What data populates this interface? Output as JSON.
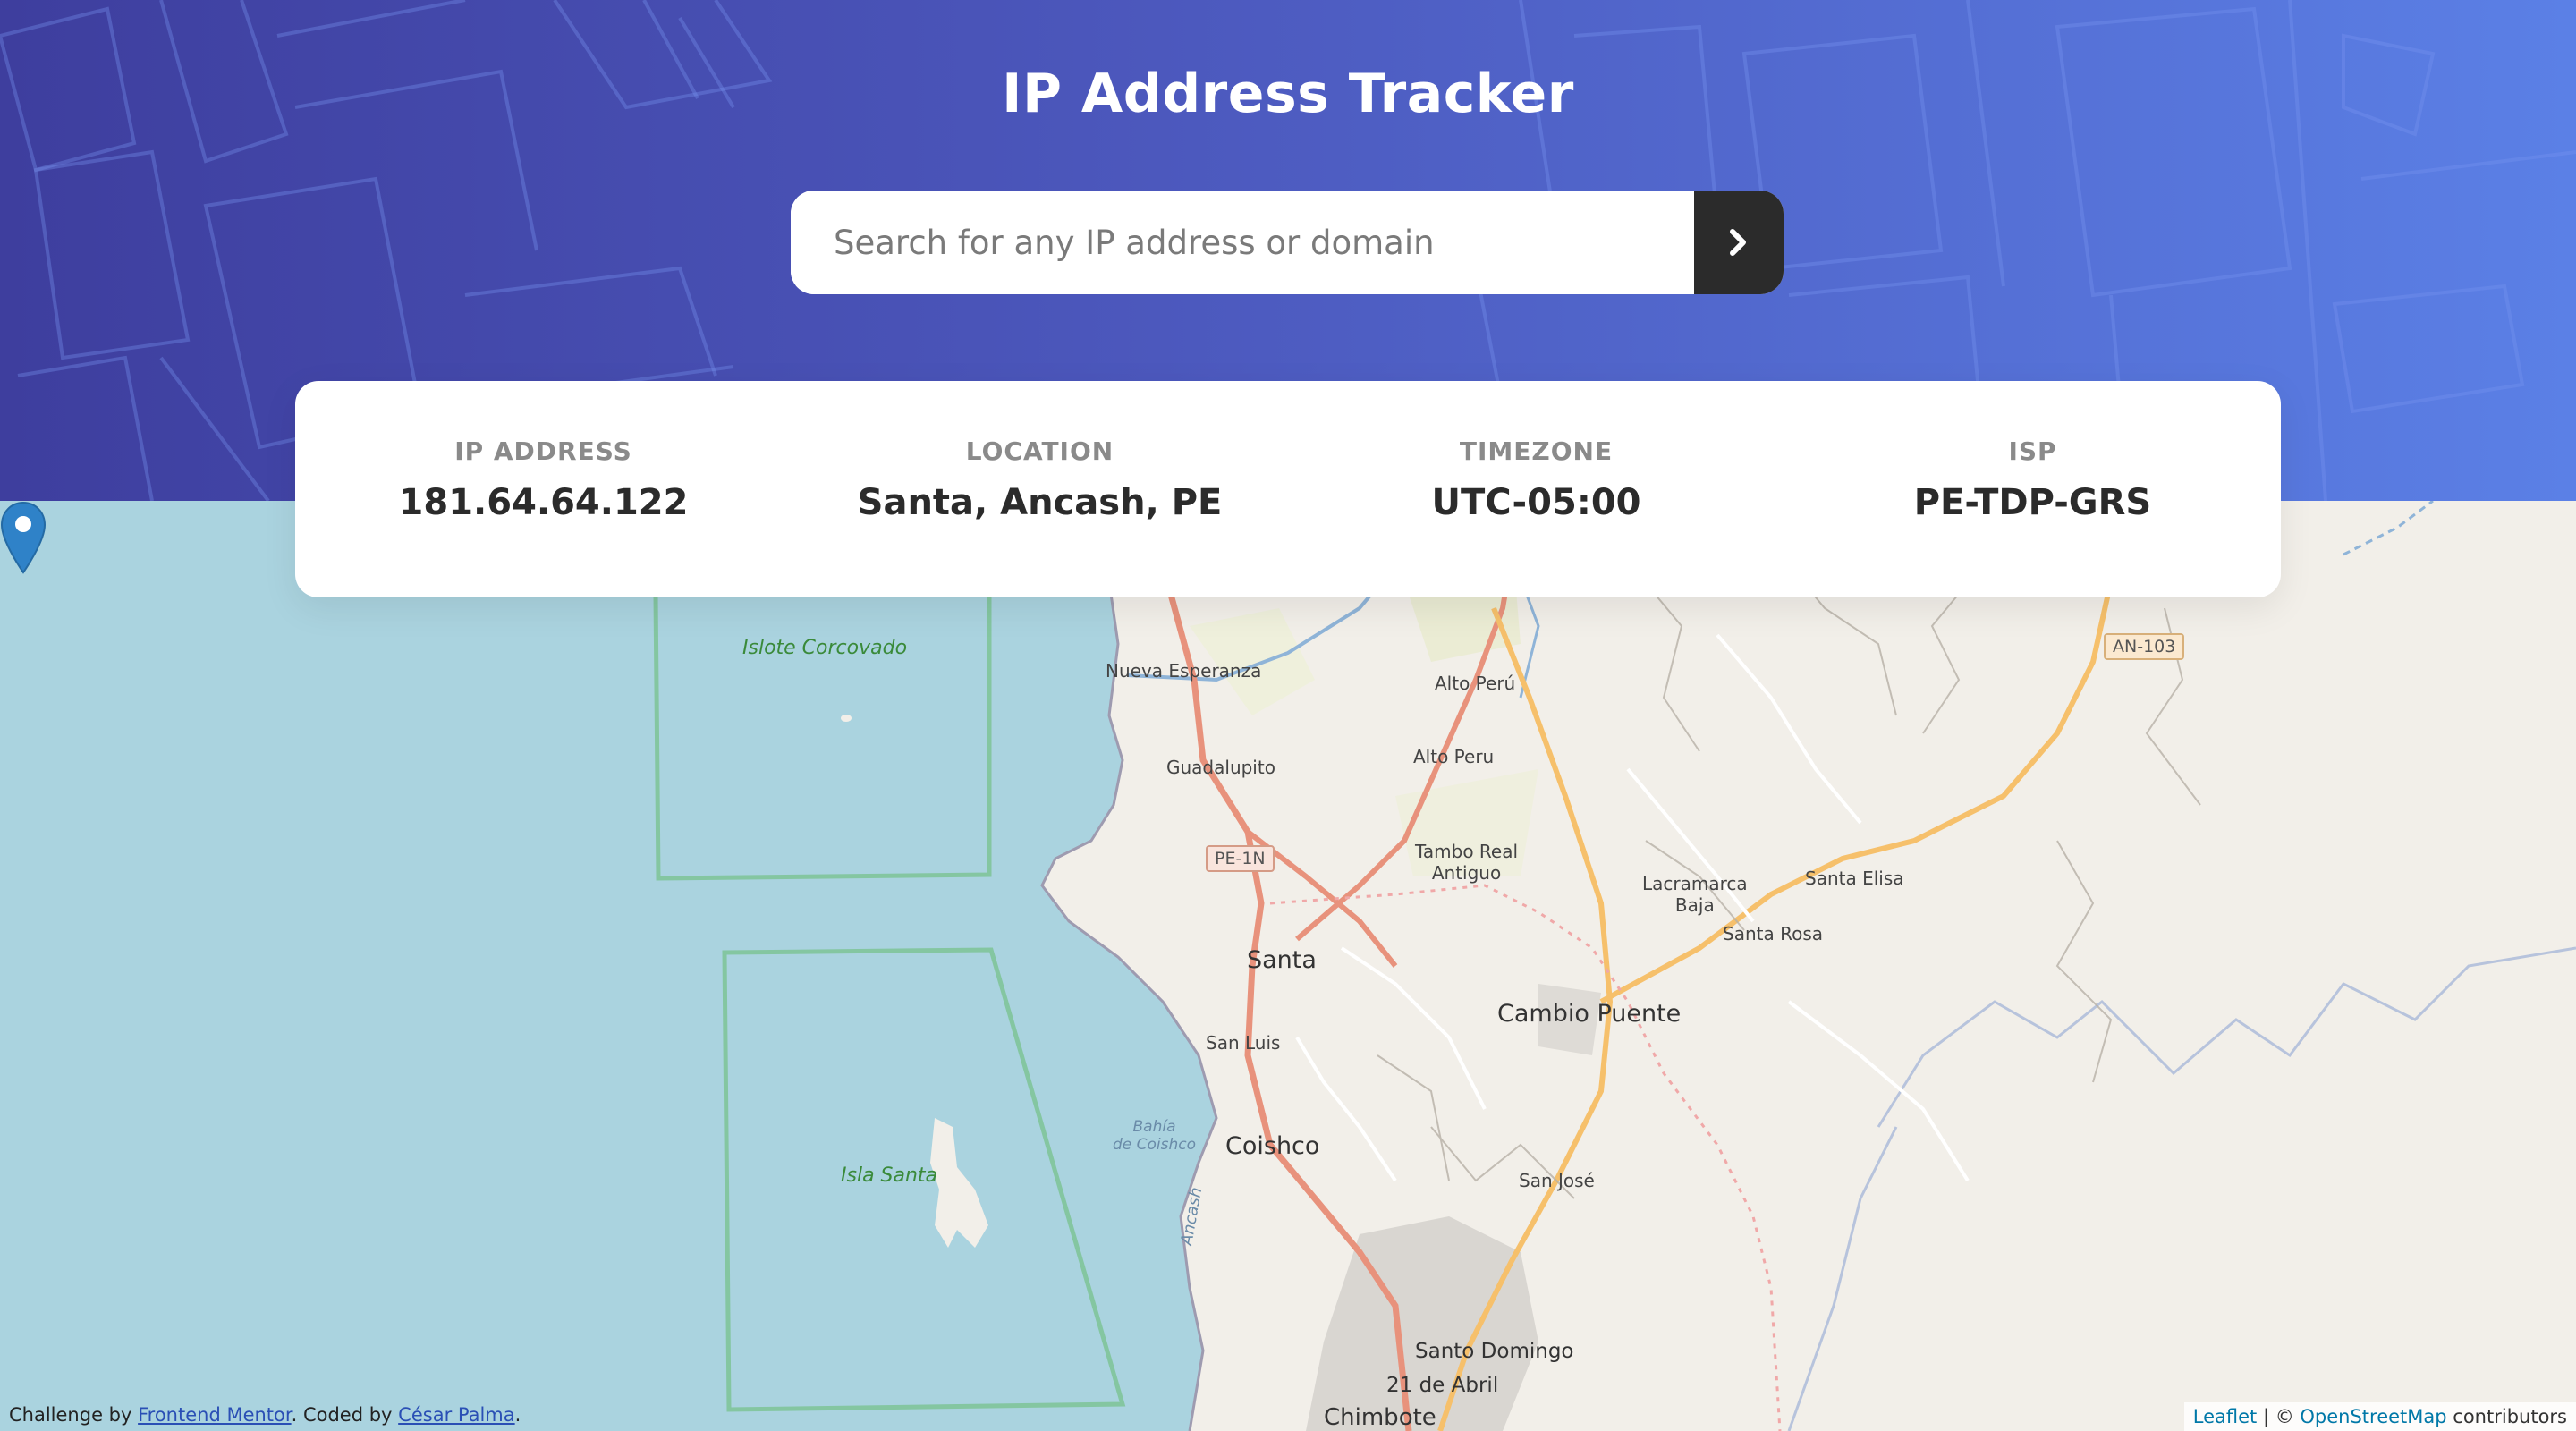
{
  "header": {
    "title": "IP Address Tracker",
    "search_placeholder": "Search for any IP address or domain",
    "submit_icon": "chevron-right-icon"
  },
  "info": {
    "ip_label": "IP ADDRESS",
    "ip_value": "181.64.64.122",
    "location_label": "LOCATION",
    "location_value": "Santa, Ancash, PE",
    "timezone_label": "TIMEZONE",
    "timezone_value": "UTC-05:00",
    "isp_label": "ISP",
    "isp_value": "PE-TDP-GRS"
  },
  "map": {
    "labels": {
      "islote": "Islote Corcovado",
      "isla_santa": "Isla Santa",
      "nueva_esperanza": "Nueva Esperanza",
      "guadalupito": "Guadalupito",
      "alto_peru_1": "Alto Perú",
      "alto_peru_2": "Alto Peru",
      "tambo_real": "Tambo Real\nAntiguo",
      "pe1n": "PE-1N",
      "an103": "AN-103",
      "lacramarca": "Lacramarca\nBaja",
      "santa_elisa": "Santa Elisa",
      "santa_rosa": "Santa Rosa",
      "santa": "Santa",
      "cambio_puente": "Cambio Puente",
      "san_luis": "San Luis",
      "bahia": "Bahía\nde Coishco",
      "coishco": "Coishco",
      "ancash": "Ancash",
      "san_jose": "San José",
      "santo_domingo": "Santo Domingo",
      "abril": "21 de Abril",
      "chimbote": "Chimbote"
    },
    "marker_icon": "map-pin-icon",
    "colors": {
      "water": "#aad3df",
      "land": "#f2efe9",
      "road_primary": "#e8927c",
      "road_secondary": "#f6c06b",
      "boundary": "#74c08a"
    }
  },
  "footer": {
    "challenge_prefix": "Challenge by ",
    "frontend_mentor": "Frontend Mentor",
    "coded_by": ". Coded by ",
    "author": "César Palma",
    "period": ".",
    "leaflet": "Leaflet",
    "separator": " | © ",
    "osm": "OpenStreetMap",
    "contributors": " contributors"
  }
}
